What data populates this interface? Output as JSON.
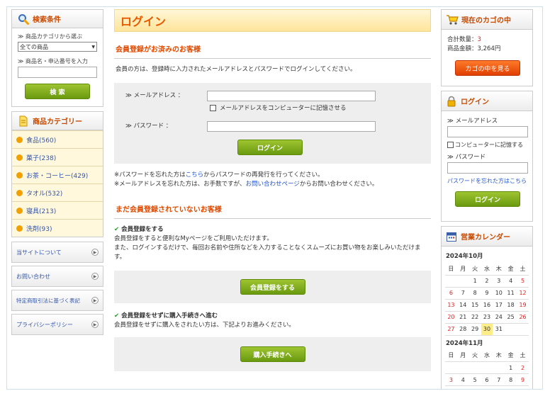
{
  "search": {
    "title": "検索条件",
    "category_label": "≫ 商品カテゴリから選ぶ",
    "category_value": "全ての商品",
    "keyword_label": "≫ 商品名・申込番号を入力",
    "button": "検 索"
  },
  "categories": {
    "title": "商品カテゴリー",
    "items": [
      "食品(560)",
      "菓子(238)",
      "お茶・コーヒー(429)",
      "タオル(532)",
      "寝具(213)",
      "洗剤(93)"
    ]
  },
  "nav": [
    "当サイトについて",
    "お問い合わせ",
    "特定商取引法に基づく表記",
    "プライバシーポリシー"
  ],
  "main": {
    "title": "ログイン",
    "member_heading": "会員登録がお済みのお客様",
    "member_intro": "会員の方は、登録時に入力されたメールアドレスとパスワードでログインしてください。",
    "email_label": "≫ メールアドレス ：",
    "remember_email": "メールアドレスをコンピューターに記憶させる",
    "password_label": "≫ パスワード ：",
    "login_button": "ログイン",
    "forgot_pw_pre": "※パスワードを忘れた方は",
    "forgot_pw_link": "こちら",
    "forgot_pw_post": "からパスワードの再発行を行ってください。",
    "forgot_mail_pre": "※メールアドレスを忘れた方は、お手数ですが、",
    "forgot_mail_link": "お問い合わせページ",
    "forgot_mail_post": "からお問い合わせください。",
    "nonmember_heading": "まだ会員登録されていないお客様",
    "register_title": "会員登録をする",
    "register_text1": "会員登録をすると便利なMyページをご利用いただけます。",
    "register_text2": "また、ログインするだけで、毎回お名前や住所などを入力することなくスムーズにお買い物をお楽しみいただけます。",
    "register_button": "会員登録をする",
    "guest_title": "会員登録をせずに購入手続きへ進む",
    "guest_text": "会員登録をせずに購入をされたい方は、下記よりお進みください。",
    "guest_button": "購入手続きへ"
  },
  "cart": {
    "title": "現在のカゴの中",
    "qty_label": "合計数量：",
    "qty_value": "3",
    "amount_label": "商品金額：",
    "amount_value": "3,264円",
    "button": "カゴの中を見る"
  },
  "side_login": {
    "title": "ログイン",
    "email_label": "≫ メールアドレス",
    "remember": "コンピューターに記憶する",
    "password_label": "≫ パスワード",
    "forgot": "パスワードを忘れた方はこちら",
    "button": "ログイン"
  },
  "calendar": {
    "title": "営業カレンダー",
    "month1": "2024年10月",
    "month2": "2024年11月",
    "weekdays": [
      "日",
      "月",
      "火",
      "水",
      "木",
      "金",
      "土"
    ],
    "oct_rows": [
      [
        "",
        "",
        "1",
        "2",
        "3",
        "4",
        "5"
      ],
      [
        "6",
        "7",
        "8",
        "9",
        "10",
        "11",
        "12"
      ],
      [
        "13",
        "14",
        "15",
        "16",
        "17",
        "18",
        "19"
      ],
      [
        "20",
        "21",
        "22",
        "23",
        "24",
        "25",
        "26"
      ],
      [
        "27",
        "28",
        "29",
        "30",
        "31",
        "",
        ""
      ]
    ],
    "nov_rows": [
      [
        "",
        "",
        "",
        "",
        "",
        "1",
        "2"
      ],
      [
        "3",
        "4",
        "5",
        "6",
        "7",
        "8",
        "9"
      ]
    ]
  }
}
